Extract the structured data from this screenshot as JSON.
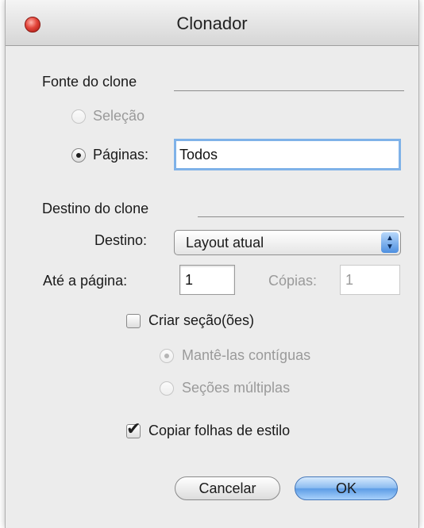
{
  "window": {
    "title": "Clonador"
  },
  "source": {
    "heading": "Fonte do clone",
    "selection_label": "Seleção",
    "pages_label": "Páginas:",
    "pages_value": "Todos"
  },
  "destination": {
    "heading": "Destino do clone",
    "destino_label": "Destino:",
    "destino_value": "Layout atual",
    "ate_label": "Até a página:",
    "ate_value": "1",
    "copias_label": "Cópias:",
    "copias_value": "1",
    "criar_label": "Criar seção(ões)",
    "mantelas_label": "Mantê-las contíguas",
    "secoes_label": "Seções múltiplas",
    "copiar_label": "Copiar folhas de estilo"
  },
  "buttons": {
    "cancel": "Cancelar",
    "ok": "OK"
  },
  "icons": {
    "checkmark": "✔",
    "arrow_up": "▲",
    "arrow_down": "▼"
  }
}
